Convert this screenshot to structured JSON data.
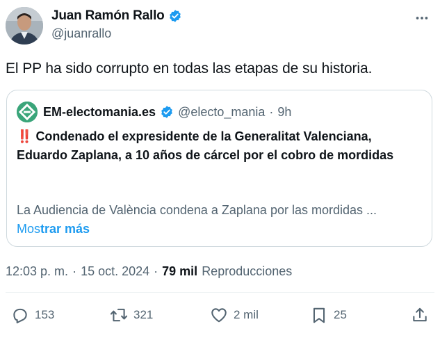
{
  "author": {
    "name": "Juan Ramón Rallo",
    "handle": "@juanrallo"
  },
  "tweet": {
    "text": "El PP ha sido corrupto en todas las etapas de su historia."
  },
  "quote": {
    "name": "EM-electomania.es",
    "handle": "@electo_mania",
    "separator": "·",
    "time": "9h",
    "bang": "‼️",
    "title": "Condenado el expresidente de la Generalitat Valenciana, Eduardo Zaplana, a 10 años de cárcel por el cobro de mordidas",
    "body": "La Audiencia de València condena a Zaplana por las mordidas ...",
    "more_prefix": "Mos",
    "more_suffix": "trar más"
  },
  "meta": {
    "time": "12:03 p. m.",
    "sep1": "·",
    "date": "15 oct. 2024",
    "sep2": "·",
    "views_count": "79 mil",
    "views_label": "Reproducciones"
  },
  "actions": {
    "replies": "153",
    "retweets": "321",
    "likes": "2 mil",
    "bookmarks": "25"
  },
  "colors": {
    "accent": "#1d9bf0",
    "muted": "#536471",
    "border": "#cfd9de",
    "logo": "#3aa57a",
    "alert": "#e0245e"
  },
  "icons": [
    "verified-badge-icon",
    "more-icon",
    "reply-icon",
    "retweet-icon",
    "like-icon",
    "bookmark-icon",
    "share-icon"
  ]
}
